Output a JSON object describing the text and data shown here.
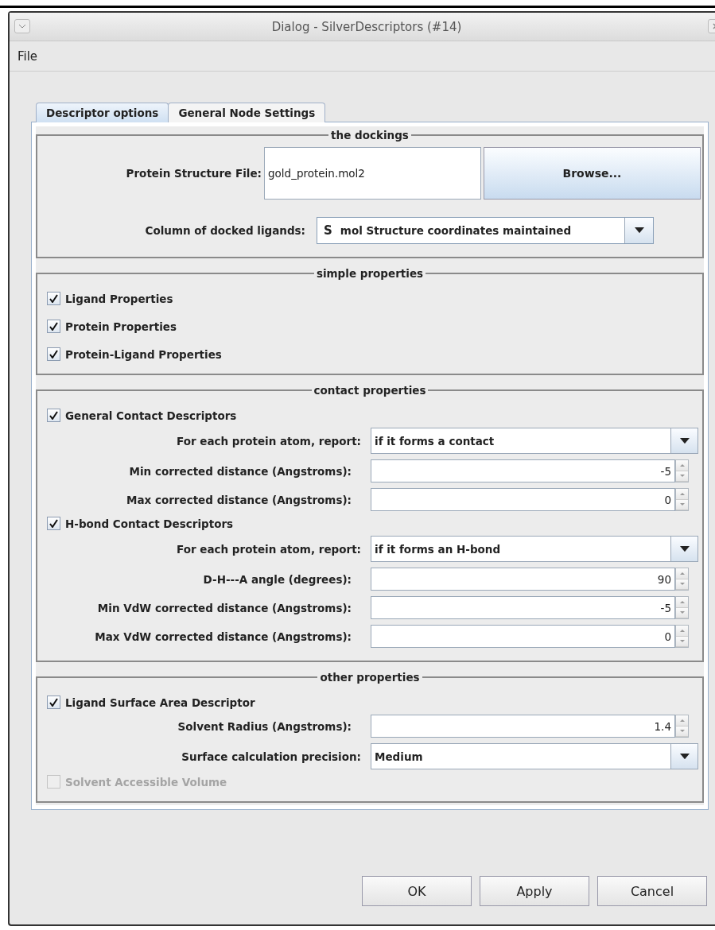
{
  "window": {
    "title": "Dialog - SilverDescriptors (#14)"
  },
  "menu": [
    "File"
  ],
  "tabs": [
    {
      "label": "Descriptor options",
      "selected": true
    },
    {
      "label": "General Node Settings",
      "selected": false
    }
  ],
  "groups": [
    {
      "title": "the dockings",
      "rows": [
        {
          "kind": "file",
          "label": "Protein Structure File:",
          "value": "gold_protein.mol2",
          "button": "Browse..."
        },
        {
          "kind": "combo",
          "label": "Column of docked ligands:",
          "badge": "S",
          "value": "mol Structure coordinates maintained"
        }
      ]
    },
    {
      "title": "simple properties",
      "rows": [
        {
          "kind": "checkbox",
          "label": "Ligand Properties",
          "checked": true,
          "disabled": false
        },
        {
          "kind": "checkbox",
          "label": "Protein Properties",
          "checked": true,
          "disabled": false
        },
        {
          "kind": "checkbox",
          "label": "Protein-Ligand Properties",
          "checked": true,
          "disabled": false
        }
      ]
    },
    {
      "title": "contact properties",
      "rows": [
        {
          "kind": "checkbox",
          "label": "General Contact Descriptors",
          "checked": true,
          "disabled": false
        },
        {
          "kind": "select",
          "label": "For each protein atom, report:",
          "value": "if it forms a contact"
        },
        {
          "kind": "spinner",
          "label": "Min corrected distance (Angstroms):",
          "value": "-5"
        },
        {
          "kind": "spinner",
          "label": "Max corrected distance (Angstroms):",
          "value": "0"
        },
        {
          "kind": "checkbox",
          "label": "H-bond Contact Descriptors",
          "checked": true,
          "disabled": false
        },
        {
          "kind": "select",
          "label": "For each protein atom, report:",
          "value": "if it forms an H-bond"
        },
        {
          "kind": "spinner",
          "label": "D-H---A angle (degrees):",
          "value": "90"
        },
        {
          "kind": "spinner",
          "label": "Min VdW corrected distance (Angstroms):",
          "value": "-5"
        },
        {
          "kind": "spinner",
          "label": "Max VdW corrected distance (Angstroms):",
          "value": "0"
        }
      ]
    },
    {
      "title": "other properties",
      "rows": [
        {
          "kind": "checkbox",
          "label": "Ligand Surface Area Descriptor",
          "checked": true,
          "disabled": false
        },
        {
          "kind": "spinner",
          "label": "Solvent Radius (Angstroms):",
          "value": "1.4"
        },
        {
          "kind": "select",
          "label": "Surface calculation precision:",
          "value": "Medium"
        },
        {
          "kind": "checkbox",
          "label": "Solvent Accessible Volume",
          "checked": false,
          "disabled": true
        }
      ]
    }
  ],
  "buttons": [
    "OK",
    "Apply",
    "Cancel"
  ]
}
